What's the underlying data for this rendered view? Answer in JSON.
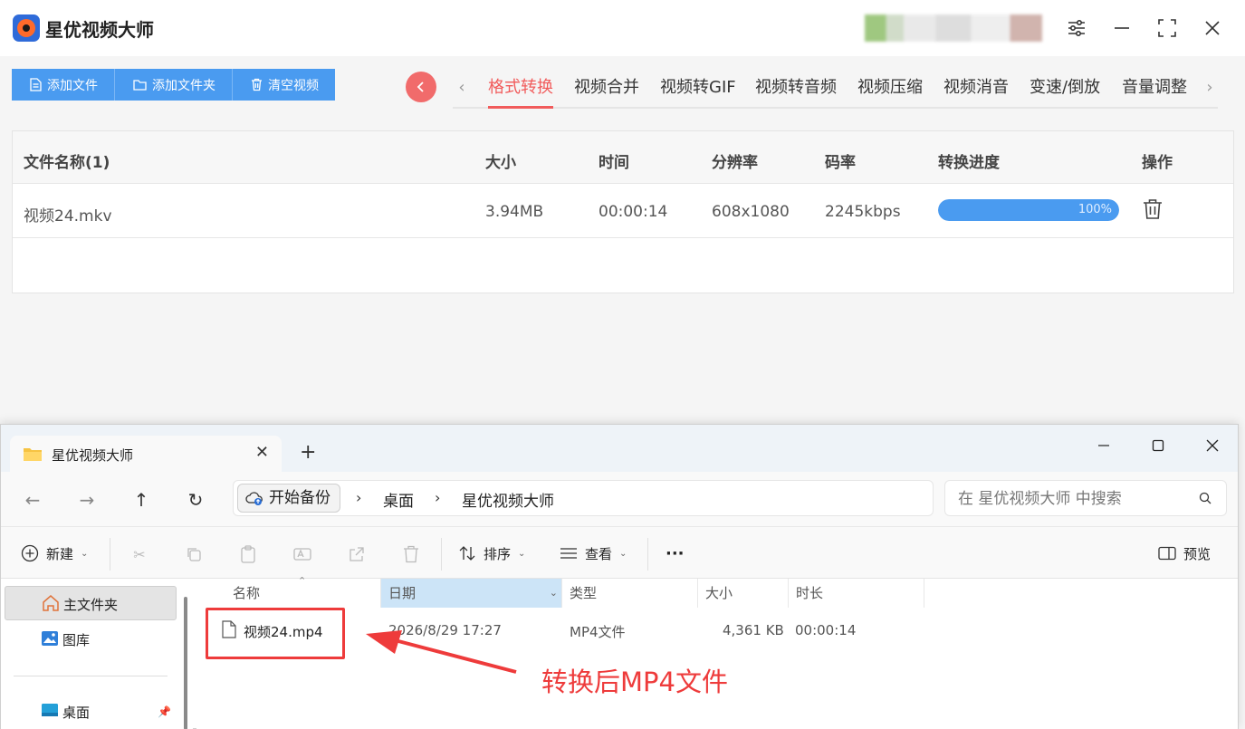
{
  "app": {
    "title": "星优视频大师",
    "toolbar": {
      "add_file": "添加文件",
      "add_folder": "添加文件夹",
      "clear": "清空视频"
    },
    "tabs": [
      "格式转换",
      "视频合并",
      "视频转GIF",
      "视频转音频",
      "视频压缩",
      "视频消音",
      "变速/倒放",
      "音量调整"
    ],
    "active_tab": "格式转换",
    "table": {
      "headers": {
        "name": "文件名称(1)",
        "size": "大小",
        "time": "时间",
        "resolution": "分辨率",
        "bitrate": "码率",
        "progress": "转换进度",
        "action": "操作"
      },
      "rows": [
        {
          "name": "视频24.mkv",
          "size": "3.94MB",
          "time": "00:00:14",
          "resolution": "608x1080",
          "bitrate": "2245kbps",
          "progress_label": "100%",
          "progress": 1.0
        }
      ]
    },
    "colors": {
      "accent_blue": "#4a9bf0",
      "accent_red": "#f15b5b"
    }
  },
  "explorer": {
    "tab_title": "星优视频大师",
    "breadcrumb": {
      "root": "开始备份",
      "segments": [
        "桌面",
        "星优视频大师"
      ]
    },
    "search_placeholder": "在 星优视频大师 中搜索",
    "commands": {
      "new": "新建",
      "sort": "排序",
      "view": "查看",
      "more": "···",
      "preview": "预览"
    },
    "sidebar": {
      "home": "主文件夹",
      "gallery": "图库",
      "desktop": "桌面"
    },
    "columns": {
      "name": "名称",
      "date": "日期",
      "type": "类型",
      "size": "大小",
      "duration": "时长"
    },
    "files": [
      {
        "name": "视频24.mp4",
        "date": "2026/8/29 17:27",
        "type": "MP4文件",
        "size": "4,361 KB",
        "duration": "00:00:14"
      }
    ]
  },
  "annotation": {
    "text": "转换后MP4文件",
    "color": "#ee3b3b"
  }
}
